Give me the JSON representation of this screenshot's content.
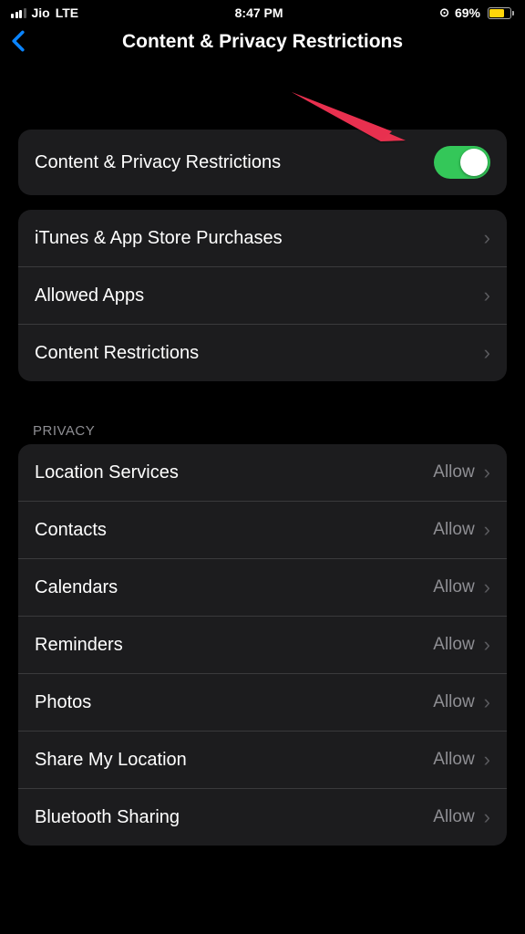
{
  "status": {
    "carrier": "Jio",
    "network": "LTE",
    "time": "8:47 PM",
    "battery": "69%"
  },
  "header": {
    "title": "Content & Privacy Restrictions"
  },
  "toggle_row": {
    "label": "Content & Privacy Restrictions"
  },
  "group1": {
    "items": [
      {
        "label": "iTunes & App Store Purchases"
      },
      {
        "label": "Allowed Apps"
      },
      {
        "label": "Content Restrictions"
      }
    ]
  },
  "privacy": {
    "header": "PRIVACY",
    "allow": "Allow",
    "items": [
      {
        "label": "Location Services"
      },
      {
        "label": "Contacts"
      },
      {
        "label": "Calendars"
      },
      {
        "label": "Reminders"
      },
      {
        "label": "Photos"
      },
      {
        "label": "Share My Location"
      },
      {
        "label": "Bluetooth Sharing"
      }
    ]
  }
}
